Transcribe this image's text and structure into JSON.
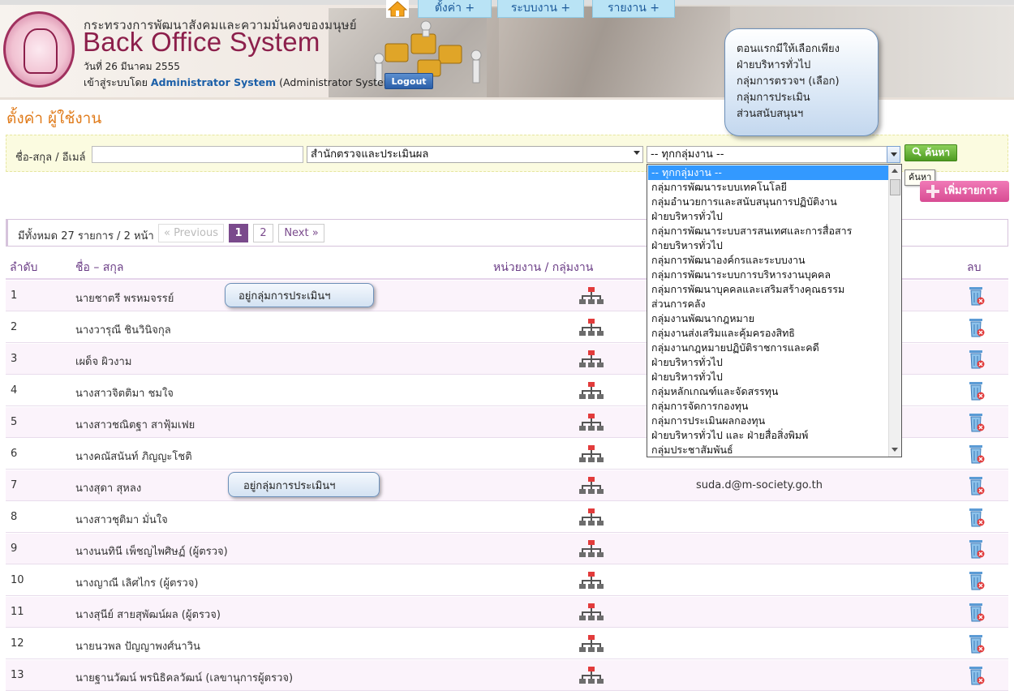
{
  "header": {
    "ministry": "กระทรวงการพัฒนาสังคมและความมั่นคงของมนุษย์",
    "brand": "Back Office System",
    "date": "วันที่ 26 มีนาคม 2555",
    "login_prefix": "เข้าสู่ระบบโดย",
    "user_name": "Administrator System",
    "user_role": "(Administrator System)",
    "logout": "Logout"
  },
  "nav": {
    "tabs": [
      {
        "label": "ตั้งค่า  +"
      },
      {
        "label": "ระบบงาน  +"
      },
      {
        "label": "รายงาน  +"
      }
    ]
  },
  "page": {
    "title": "ตั้งค่า ผู้ใช้งาน"
  },
  "search": {
    "name_label": "ชื่อ-สกุล / อีเมล์",
    "name_value": "",
    "office_value": "สำนักตรวจและประเมินผล",
    "group_value": "-- ทุกกลุ่มงาน --",
    "search_button": "ค้นหา",
    "tooltip": "ค้นหา"
  },
  "add_button": "เพิ่มรายการ",
  "annotations": {
    "bubble": [
      "ตอนแรกมีให้เลือกเพียง",
      "ฝ่ายบริหารทั่วไป",
      "กลุ่มการตรวจฯ (เลือก)",
      "กลุ่มการประเมิน",
      "ส่วนสนับสนุนฯ"
    ],
    "callout_1": "อยู่กลุ่มการประเมินฯ",
    "callout_2": "อยู่กลุ่มการประเมินฯ"
  },
  "dropdown_options": [
    "-- ทุกกลุ่มงาน --",
    "กลุ่มการพัฒนาระบบเทคโนโลยี",
    "กลุ่มอำนวยการและสนับสนุนการปฏิบัติงาน",
    "ฝ่ายบริหารทั่วไป",
    "กลุ่มการพัฒนาระบบสารสนเทศและการสื่อสาร",
    "ฝ่ายบริหารทั่วไป",
    "กลุ่มการพัฒนาองค์กรและระบบงาน",
    "กลุ่มการพัฒนาระบบการบริหารงานบุคคล",
    "กลุ่มการพัฒนาบุคคลและเสริมสร้างคุณธรรม",
    "ส่วนการคลัง",
    "กลุ่มงานพัฒนากฎหมาย",
    "กลุ่มงานส่งเสริมและคุ้มครองสิทธิ",
    "กลุ่มงานกฎหมายปฏิบัติราชการและคดี",
    "ฝ่ายบริหารทั่วไป",
    "ฝ่ายบริหารทั่วไป",
    "กลุ่มหลักเกณฑ์และจัดสรรทุน",
    "กลุ่มการจัดการกองทุน",
    "กลุ่มการประเมินผลกองทุน",
    "ฝ่ายบริหารทั่วไป และ ฝ่ายสื่อสิ่งพิมพ์",
    "กลุ่มประชาสัมพันธ์"
  ],
  "pager": {
    "info": "มีทั้งหมด 27 รายการ / 2 หน้า",
    "previous": "« Previous",
    "pages": [
      "1",
      "2"
    ],
    "next": "Next »"
  },
  "table": {
    "headers": {
      "no": "ลำดับ",
      "name": "ชื่อ – สกุล",
      "unit": "หน่วยงาน / กลุ่มงาน",
      "delete": "ลบ"
    },
    "rows": [
      {
        "no": "1",
        "name": "นายชาตรี พรหมจรรย์",
        "email": ""
      },
      {
        "no": "2",
        "name": "นางวารุณี ชินวินิจกุล",
        "email": ""
      },
      {
        "no": "3",
        "name": "เผด็จ ผิวงาม",
        "email": ""
      },
      {
        "no": "4",
        "name": "นางสาวจิตติมา ชมใจ",
        "email": ""
      },
      {
        "no": "5",
        "name": "นางสาวชณิตฐา สาฟุ้มเฟย",
        "email": ""
      },
      {
        "no": "6",
        "name": "นางคณัสนันท์ ภิญญะโชติ",
        "email": ""
      },
      {
        "no": "7",
        "name": "นางสุดา สุหลง",
        "email": "suda.d@m-society.go.th"
      },
      {
        "no": "8",
        "name": "นางสาวชุติมา มั่นใจ",
        "email": ""
      },
      {
        "no": "9",
        "name": "นางนนทินี เพ็ชญไพศิษฏ์ (ผู้ตรวจ)",
        "email": ""
      },
      {
        "no": "10",
        "name": "นางญาณี เลิศไกร (ผู้ตรวจ)",
        "email": ""
      },
      {
        "no": "11",
        "name": "นางสุนีย์ สายสุพัฒน์ผล (ผู้ตรวจ)",
        "email": ""
      },
      {
        "no": "12",
        "name": "นายนวพล ปัญญาพงศ์นาวิน",
        "email": ""
      },
      {
        "no": "13",
        "name": "นายฐานวัฒน์ พรนิธิคลวัฒน์ (เลขานุการผู้ตรวจ)",
        "email": ""
      }
    ]
  },
  "colors": {
    "brand": "#8c1f4b",
    "title_orange": "#e07b1b",
    "header_purple": "#6b3d86",
    "nav_tab": "#b9e3f5",
    "search_green": "#4e9b21",
    "add_pink": "#d84c93",
    "dropdown_selected": "#3399ff"
  },
  "icons": {
    "home": "home-icon",
    "org": "org-chart-icon",
    "delete": "trash-icon",
    "search": "magnifier-icon",
    "add": "plus-icon"
  }
}
